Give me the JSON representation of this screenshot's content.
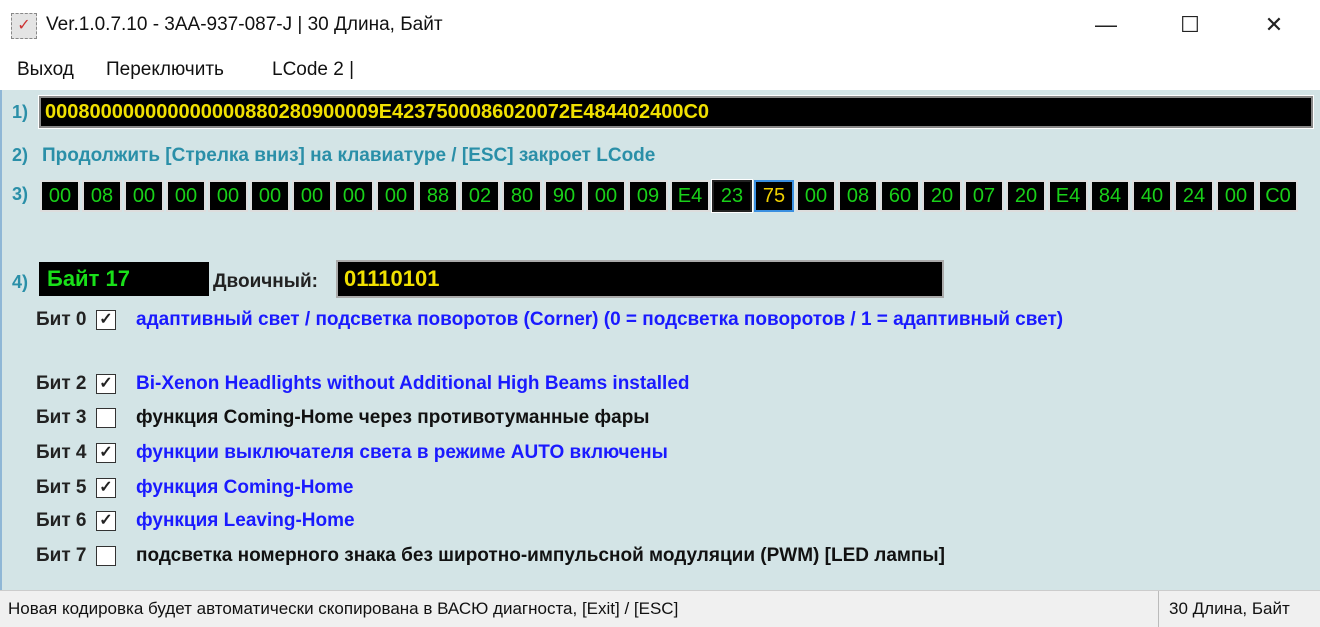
{
  "window": {
    "title": "Ver.1.0.7.10 -   3AA-937-087-J | 30 Длина, Байт",
    "minimize": "—",
    "maximize": "☐",
    "close": "✕"
  },
  "menu": [
    "Выход",
    "Переключить",
    "LCode 2 |"
  ],
  "labels": {
    "n1": "1)",
    "n2": "2)",
    "n3": "3)",
    "n4": "4)"
  },
  "coding": "000800000000000000880280900009E4237500086020072E484402400C0",
  "hint": "Продолжить [Стрелка вниз] на клавиатуре / [ESC] закроет LCode",
  "bytes": [
    "00",
    "08",
    "00",
    "00",
    "00",
    "00",
    "00",
    "00",
    "00",
    "88",
    "02",
    "80",
    "90",
    "00",
    "09",
    "E4",
    "23",
    "75",
    "00",
    "08",
    "60",
    "20",
    "07",
    "20",
    "E4",
    "84",
    "40",
    "24",
    "00",
    "C0"
  ],
  "selected_byte_index": 17,
  "byte_label": "Байт 17",
  "binary_label": "Двоичный:",
  "binary": "01110101",
  "bits": [
    {
      "label": "Бит 0",
      "checked": true,
      "text": "адаптивный свет / подсветка поворотов (Corner) (0 = подсветка поворотов / 1 = адаптивный свет)"
    },
    {
      "label": "Бит 2",
      "checked": true,
      "text": "Bi-Xenon Headlights without Additional High Beams installed"
    },
    {
      "label": "Бит 3",
      "checked": false,
      "text": "функция Coming-Home через противотуманные фары"
    },
    {
      "label": "Бит 4",
      "checked": true,
      "text": "функции выключателя света в режиме AUTO включены"
    },
    {
      "label": "Бит 5",
      "checked": true,
      "text": "функция Coming-Home"
    },
    {
      "label": "Бит 6",
      "checked": true,
      "text": "функция Leaving-Home"
    },
    {
      "label": "Бит 7",
      "checked": false,
      "text": "подсветка номерного знака без широтно-импульсной модуляции (PWM) [LED лампы]"
    }
  ],
  "status": {
    "left": "Новая кодировка будет автоматически скопирована в ВАСЮ диагноста, [Exit] / [ESC]",
    "right": "30 Длина, Байт"
  }
}
